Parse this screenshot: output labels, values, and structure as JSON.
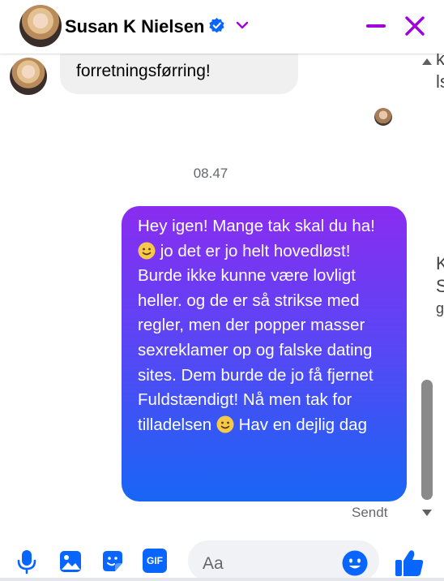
{
  "header": {
    "name": "Susan K Nielsen"
  },
  "conversation": {
    "incoming": {
      "text": "forretningsførring!"
    },
    "timestamp": "08.47",
    "outgoing": {
      "text_parts": [
        "Hey igen! Mange tak skal du ha! ",
        " jo det er jo helt hovedløst! Burde ikke kunne være lovligt heller. og de er så strikse med regler, men der popper masser sexreklamer op og falske dating sites. Dem burde de jo få fjernet Fuldstændigt! Nå men tak for tilladelsen ",
        " Hav en dejlig dag"
      ]
    },
    "status": "Sendt"
  },
  "side_fragments": [
    "k",
    "ls",
    "K",
    "S",
    "g"
  ],
  "composer": {
    "placeholder": "Aa",
    "gif_label": "GIF"
  },
  "colors": {
    "accent": "#0866ff",
    "header_controls": "#a000e0",
    "bubble_gradient_top": "#8a2cf0",
    "bubble_gradient_bottom": "#1866f5"
  }
}
